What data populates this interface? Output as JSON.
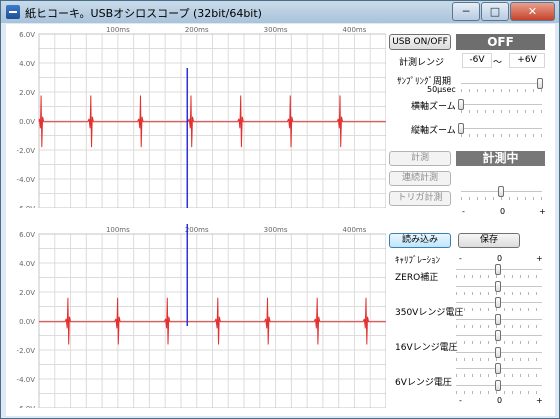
{
  "window": {
    "title": "紙ヒコーキ。USBオシロスコープ (32bit/64bit)",
    "minimize": "─",
    "maximize": "□",
    "close": "✕"
  },
  "colors": {
    "signal": "#e23030",
    "cursor": "#3030d8",
    "grid": "#dcdcdc",
    "axis_text": "#666666"
  },
  "scope": {
    "time_labels": [
      "100ms",
      "200ms",
      "300ms",
      "400ms"
    ],
    "volt_labels": [
      "6.0V",
      "4.0V",
      "2.0V",
      "0.0V",
      "-2.0V",
      "-4.0V",
      "-6.0V"
    ],
    "top": {
      "spike_ms": [
        3,
        66,
        129,
        193,
        256,
        319,
        382
      ],
      "spike_height": 1.1,
      "spike_depth": 1.0
    },
    "bottom": {
      "spike_ms": [
        37,
        100,
        163,
        227,
        290,
        353,
        415
      ],
      "spike_height": 1.0,
      "spike_depth": 0.9
    },
    "cursor_ms": 188
  },
  "panel": {
    "usb_button": "USB ON/OFF",
    "usb_status": "OFF",
    "range_label": "計測レンジ",
    "range_min": "-6V",
    "range_sep": "〜",
    "range_max": "+6V",
    "sampling_label": "ｻﾝﾌﾟﾘﾝｸﾞ周期",
    "sampling_value": "50μsec",
    "sampling_level": 1.0,
    "hzoom_label": "横軸ズーム",
    "hzoom_level": 0.0,
    "vzoom_label": "縦軸ズーム",
    "vzoom_level": 0.0,
    "measure_button": "計測",
    "measure_status": "計測中",
    "continuous_button": "連続計測",
    "trigger_button": "トリガ計測",
    "trigger_minus": "-",
    "trigger_zero": "0",
    "trigger_plus": "+",
    "trigger_level": 0.5,
    "load_button": "読み込み",
    "save_button": "保存",
    "calibration_label": "ｷｬﾘﾌﾞﾚｰｼｮﾝ",
    "cal_minus": "-",
    "cal_zero": "0",
    "cal_plus": "+",
    "zero_label": "ZERO補正",
    "v350_label": "350Vレンジ電圧",
    "v16_label": "16Vレンジ電圧",
    "v6_label": "6Vレンジ電圧"
  }
}
